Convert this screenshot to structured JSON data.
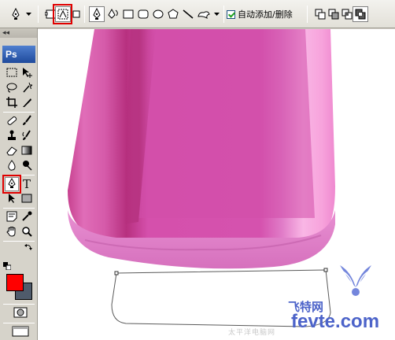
{
  "options_bar": {
    "auto_add_delete_label": "自动添加/删除",
    "auto_add_delete_checked": true,
    "icons": [
      "pen-tool-icon",
      "dropdown-arrow-icon",
      "shape-layers-icon",
      "paths-icon",
      "fill-pixels-icon",
      "pen-icon",
      "freeform-pen-icon",
      "rectangle-icon",
      "rounded-rectangle-icon",
      "ellipse-icon",
      "polygon-icon",
      "line-icon",
      "custom-shape-icon",
      "dropdown-arrow-icon",
      "add-to-path-icon",
      "subtract-from-path-icon",
      "intersect-path-icon",
      "exclude-overlap-icon"
    ]
  },
  "toolbox": {
    "collapse_glyph": "◂◂",
    "logo_text": "Ps",
    "type_tool_glyph": "T",
    "foreground_color": "#ff0000",
    "background_color": "#4f5b6b"
  },
  "canvas": {
    "bottle_colors": {
      "body_main": "#d550ac",
      "body_light": "#e776c6",
      "body_dark": "#b7307f",
      "highlight": "#f9b6e5",
      "base": "#e28ccd"
    },
    "watermark_small": "太平洋电脑网",
    "watermark_brand": "飞特网",
    "watermark_site": "fevte.com"
  },
  "highlight_color": "#e00000"
}
